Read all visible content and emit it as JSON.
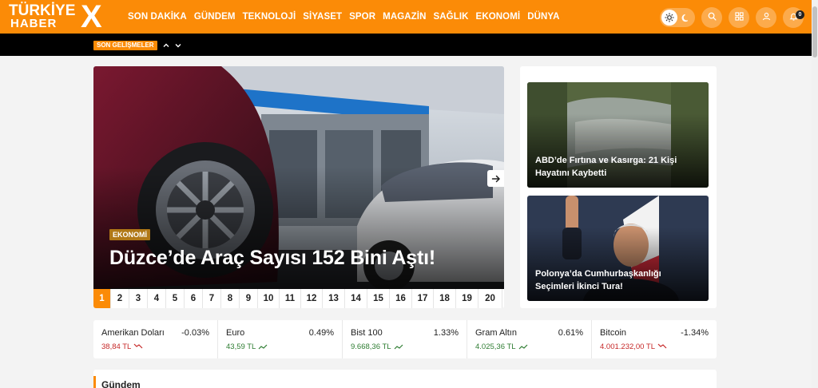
{
  "brand": {
    "line1": "TÜRKİYE",
    "line2": "HABER",
    "mark": "X"
  },
  "nav": [
    "SON DAKİKA",
    "GÜNDEM",
    "TEKNOLOJİ",
    "SİYASET",
    "SPOR",
    "MAGAZİN",
    "SAĞLIK",
    "EKONOMİ",
    "DÜNYA"
  ],
  "header_tools": {
    "notification_count": "0"
  },
  "ticker": {
    "label": "SON GELİŞMELER"
  },
  "hero": {
    "category": "EKONOMİ",
    "title": "Düzce’de Araç Sayısı 152 Bini Aştı!",
    "pages": [
      "1",
      "2",
      "3",
      "4",
      "5",
      "6",
      "7",
      "8",
      "9",
      "10",
      "11",
      "12",
      "13",
      "14",
      "15",
      "16",
      "17",
      "18",
      "19",
      "20"
    ],
    "active_page": "1"
  },
  "side_news": [
    {
      "title": "ABD’de Fırtına ve Kasırga: 21 Kişi Hayatını Kaybetti"
    },
    {
      "title": "Polonya’da Cumhurbaşkanlığı Seçimleri İkinci Tura!"
    }
  ],
  "markets": [
    {
      "name": "Amerikan Doları",
      "change": "-0.03%",
      "value": "38,84 TL",
      "direction": "down"
    },
    {
      "name": "Euro",
      "change": "0.49%",
      "value": "43,59 TL",
      "direction": "up"
    },
    {
      "name": "Bist 100",
      "change": "1.33%",
      "value": "9.668,36 TL",
      "direction": "up"
    },
    {
      "name": "Gram Altın",
      "change": "0.61%",
      "value": "4.025,36 TL",
      "direction": "up"
    },
    {
      "name": "Bitcoin",
      "change": "-1.34%",
      "value": "4.001.232,00 TL",
      "direction": "down"
    }
  ],
  "sections": {
    "gundem": "Gündem"
  },
  "colors": {
    "brand": "#fb8b07",
    "up": "#2e7d32",
    "down": "#c62828",
    "category": "#b07816"
  }
}
